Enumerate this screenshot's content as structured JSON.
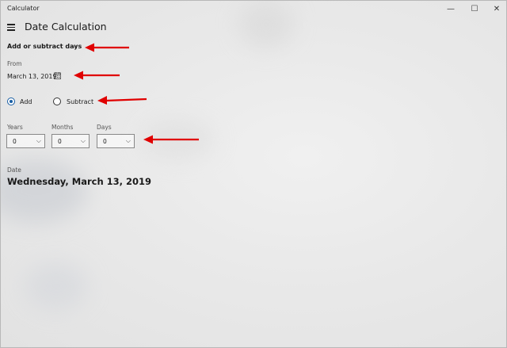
{
  "window": {
    "title": "Calculator",
    "controls": {
      "minimize": "—",
      "maximize": "☐",
      "close": "✕"
    }
  },
  "header": {
    "menu_icon": "hamburger-icon",
    "page_title": "Date Calculation"
  },
  "mode": {
    "selected": "Add or subtract days",
    "chevron": "⌵"
  },
  "from": {
    "label": "From",
    "date": "March 13, 2019",
    "icon": "calendar-icon"
  },
  "operation": {
    "add_label": "Add",
    "subtract_label": "Subtract",
    "selected": "Add"
  },
  "offsets": {
    "years": {
      "label": "Years",
      "value": "0"
    },
    "months": {
      "label": "Months",
      "value": "0"
    },
    "days": {
      "label": "Days",
      "value": "0"
    },
    "chevron": "⌵"
  },
  "result": {
    "label": "Date",
    "value": "Wednesday, March 13, 2019"
  },
  "colors": {
    "accent": "#1a5fa5",
    "annotation_arrow": "#e00000",
    "background": "#ebebeb"
  }
}
